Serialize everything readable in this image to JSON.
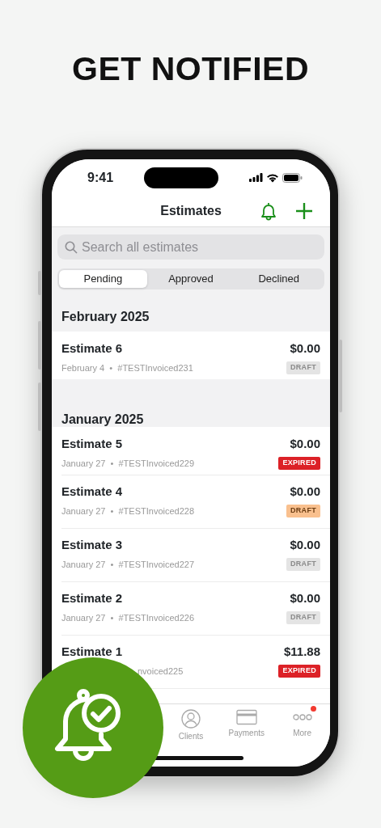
{
  "headline": "GET NOTIFIED",
  "status_bar": {
    "time": "9:41"
  },
  "nav": {
    "title": "Estimates"
  },
  "search": {
    "placeholder": "Search all estimates"
  },
  "segments": [
    {
      "label": "Pending",
      "selected": true
    },
    {
      "label": "Approved",
      "selected": false
    },
    {
      "label": "Declined",
      "selected": false
    }
  ],
  "sections": [
    {
      "title": "February 2025",
      "rows": [
        {
          "title": "Estimate 6",
          "meta": "February 4  •  #TESTInvoiced231",
          "amount": "$0.00",
          "status": "DRAFT",
          "color": "#e4e4e4"
        }
      ]
    },
    {
      "title": "January 2025",
      "rows": [
        {
          "title": "Estimate 5",
          "meta": "January 27  •  #TESTInvoiced229",
          "amount": "$0.00",
          "status": "EXPIRED",
          "color": "#dc2127"
        },
        {
          "title": "Estimate 4",
          "meta": "January 27  •  #TESTInvoiced228",
          "amount": "$0.00",
          "status": "DRAFT",
          "color": "#f9c08e"
        },
        {
          "title": "Estimate 3",
          "meta": "January 27  •  #TESTInvoiced227",
          "amount": "$0.00",
          "status": "DRAFT",
          "color": "#e4e4e4"
        },
        {
          "title": "Estimate 2",
          "meta": "January 27  •  #TESTInvoiced226",
          "amount": "$0.00",
          "status": "DRAFT",
          "color": "#e4e4e4"
        },
        {
          "title": "Estimate 1",
          "meta": "nvoiced225",
          "partly_hidden": true,
          "amount": "$11.88",
          "status": "EXPIRED",
          "color": "#dc2127"
        }
      ]
    }
  ],
  "tab_bar": [
    {
      "label": "Clients",
      "kind": "clients",
      "dot": false
    },
    {
      "label": "Payments",
      "kind": "payments",
      "dot": false
    },
    {
      "label": "More",
      "kind": "more",
      "dot": true
    }
  ]
}
